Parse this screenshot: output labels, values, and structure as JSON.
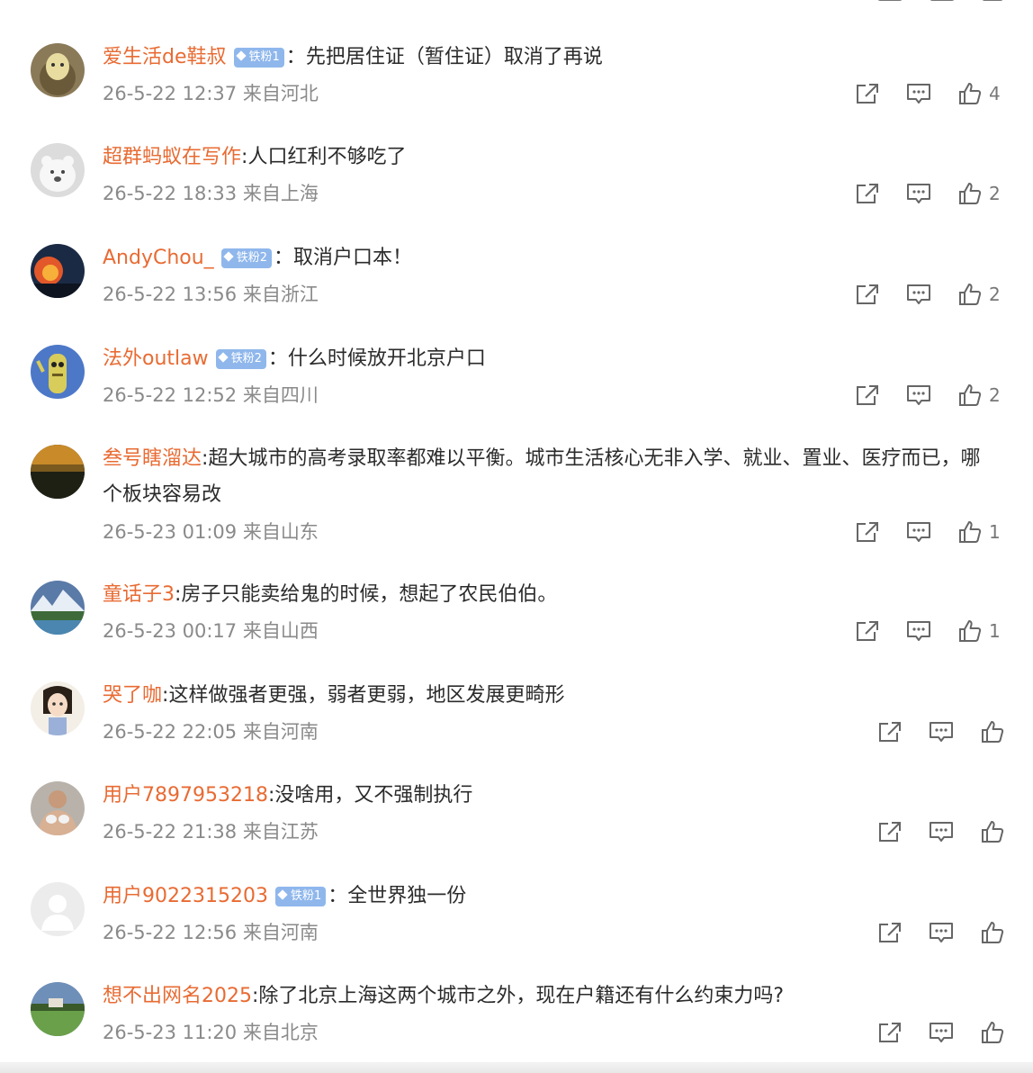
{
  "comments": [
    {
      "username": "爱生活de鞋叔",
      "badge": "铁粉1",
      "separator": "：",
      "text": "先把居住证（暂住证）取消了再说",
      "meta": "26-5-22 12:37 来自河北",
      "likes": "4",
      "avatar": "plush-toy-avatar"
    },
    {
      "username": "超群蚂蚁在写作",
      "badge": "",
      "separator": ":",
      "text": "人口红利不够吃了",
      "meta": "26-5-22 18:33 来自上海",
      "likes": "2",
      "avatar": "polar-bear-avatar"
    },
    {
      "username": "AndyChou_",
      "badge": "铁粉2",
      "separator": "：",
      "text": "取消户口本！",
      "meta": "26-5-22 13:56 来自浙江",
      "likes": "2",
      "avatar": "sunset-fire-avatar"
    },
    {
      "username": "法外outlaw",
      "badge": "铁粉2",
      "separator": "：",
      "text": "什么时候放开北京户口",
      "meta": "26-5-22 12:52 来自四川",
      "likes": "2",
      "avatar": "cartoon-character-avatar"
    },
    {
      "username": "叁号瞎溜达",
      "badge": "",
      "separator": ":",
      "text": "超大城市的高考录取率都难以平衡。城市生活核心无非入学、就业、置业、医疗而已，哪个板块容易改",
      "meta": "26-5-23 01:09 来自山东",
      "likes": "1",
      "avatar": "dusk-landscape-avatar"
    },
    {
      "username": "童话子3",
      "badge": "",
      "separator": ":",
      "text": "房子只能卖给鬼的时候，想起了农民伯伯。",
      "meta": "26-5-23 00:17 来自山西",
      "likes": "1",
      "avatar": "mountain-lake-avatar"
    },
    {
      "username": "哭了咖",
      "badge": "",
      "separator": ":",
      "text": "这样做强者更强，弱者更弱，地区发展更畸形",
      "meta": "26-5-22 22:05 来自河南",
      "likes": "",
      "avatar": "anime-girl-avatar"
    },
    {
      "username": "用户7897953218",
      "badge": "",
      "separator": ":",
      "text": "没啥用，又不强制执行",
      "meta": "26-5-22 21:38 来自江苏",
      "likes": "",
      "avatar": "person-photo-avatar"
    },
    {
      "username": "用户9022315203",
      "badge": "铁粉1",
      "separator": "：",
      "text": "全世界独一份",
      "meta": "26-5-22 12:56 来自河南",
      "likes": "",
      "avatar": "default-user-avatar"
    },
    {
      "username": "想不出网名2025",
      "badge": "",
      "separator": ":",
      "text": "除了北京上海这两个城市之外，现在户籍还有什么约束力吗?",
      "meta": "26-5-23 11:20 来自北京",
      "likes": "",
      "avatar": "green-field-avatar"
    }
  ],
  "colors": {
    "username": "#e86b33",
    "meta": "#8a8a8a",
    "badge": "#8fb7ec",
    "icon": "#666666"
  }
}
